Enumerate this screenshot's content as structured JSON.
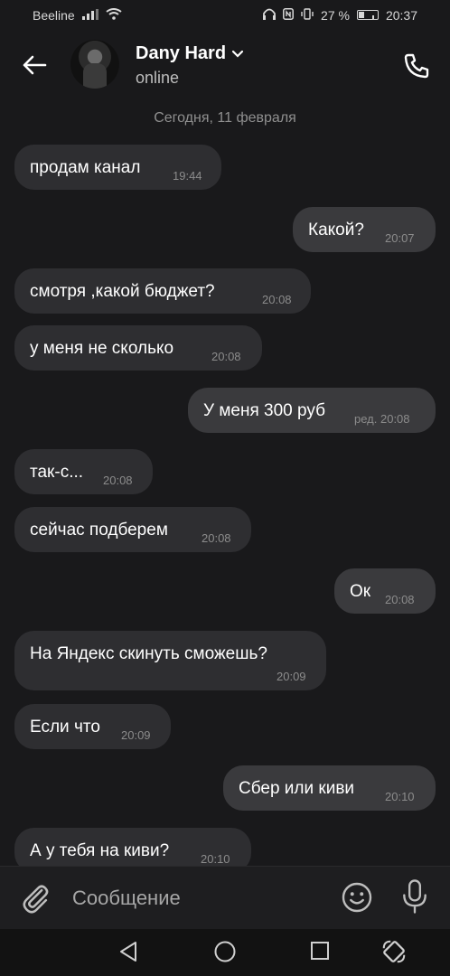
{
  "status_bar": {
    "carrier": "Beeline",
    "battery_text": "27 %",
    "time": "20:37",
    "battery_level": 0.27
  },
  "header": {
    "contact_name": "Dany Hard",
    "contact_status": "online"
  },
  "date_separator": "Сегодня, 11 февраля",
  "messages": [
    {
      "text": "продам канал",
      "time": "19:44",
      "dir": "in"
    },
    {
      "text": "Какой?",
      "time": "20:07",
      "dir": "out"
    },
    {
      "text": "смотря ,какой бюджет?",
      "time": "20:08",
      "dir": "in"
    },
    {
      "text": "у меня не сколько",
      "time": "20:08",
      "dir": "in"
    },
    {
      "text": "У меня 300 руб",
      "time": "ред. 20:08",
      "dir": "out"
    },
    {
      "text": "так-с...",
      "time": "20:08",
      "dir": "in"
    },
    {
      "text": "сейчас подберем",
      "time": "20:08",
      "dir": "in"
    },
    {
      "text": "Ок",
      "time": "20:08",
      "dir": "out"
    },
    {
      "text": "На Яндекс скинуть сможешь?",
      "time": "20:09",
      "dir": "in"
    },
    {
      "text": "Если что",
      "time": "20:09",
      "dir": "in"
    },
    {
      "text": "Сбер или киви",
      "time": "20:10",
      "dir": "out"
    },
    {
      "text": "А у тебя на киви?",
      "time": "20:10",
      "dir": "in"
    }
  ],
  "composer": {
    "placeholder": "Сообщение"
  },
  "icons": {
    "back": "arrow-left-icon",
    "call": "phone-icon",
    "attach": "paperclip-icon",
    "emoji": "smiley-icon",
    "mic": "microphone-icon",
    "nav_back": "triangle-back-icon",
    "nav_home": "circle-home-icon",
    "nav_recents": "square-recents-icon",
    "rotate": "rotate-screen-icon"
  }
}
